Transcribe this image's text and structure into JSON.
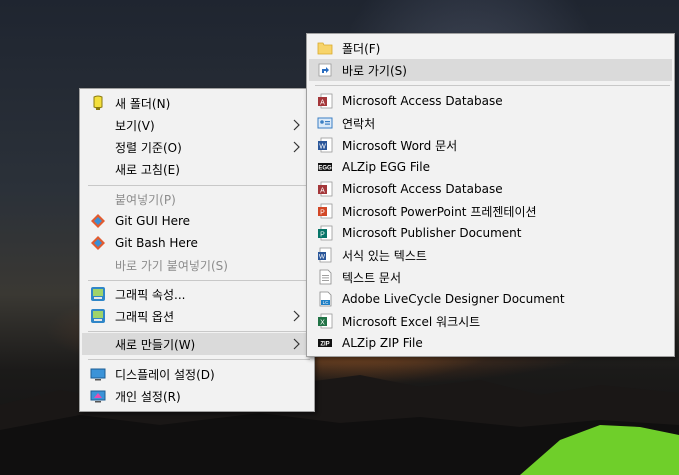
{
  "context_menu": {
    "items": [
      {
        "label": "새 폴더(N)",
        "icon": "new-folder-icon"
      },
      {
        "label": "보기(V)"
      },
      {
        "label": "정렬 기준(O)"
      },
      {
        "label": "새로 고침(E)"
      },
      {
        "label": "붙여넣기(P)"
      },
      {
        "label": "Git GUI Here",
        "icon": "git-gui-icon"
      },
      {
        "label": "Git Bash Here",
        "icon": "git-bash-icon"
      },
      {
        "label": "바로 가기 붙여넣기(S)"
      },
      {
        "label": "그래픽 속성...",
        "icon": "graphics-properties-icon"
      },
      {
        "label": "그래픽 옵션",
        "icon": "graphics-options-icon"
      },
      {
        "label": "새로 만들기(W)"
      },
      {
        "label": "디스플레이 설정(D)",
        "icon": "display-settings-icon"
      },
      {
        "label": "개인 설정(R)",
        "icon": "personalize-icon"
      }
    ]
  },
  "new_submenu": {
    "items": [
      {
        "label": "폴더(F)",
        "icon": "folder-icon"
      },
      {
        "label": "바로 가기(S)",
        "icon": "shortcut-icon"
      },
      {
        "label": "Microsoft Access Database",
        "icon": "access-icon"
      },
      {
        "label": "연락처",
        "icon": "contact-icon"
      },
      {
        "label": "Microsoft Word 문서",
        "icon": "word-icon"
      },
      {
        "label": "ALZip EGG File",
        "icon": "alzip-egg-icon"
      },
      {
        "label": "Microsoft Access Database",
        "icon": "access-icon"
      },
      {
        "label": "Microsoft PowerPoint 프레젠테이션",
        "icon": "powerpoint-icon"
      },
      {
        "label": "Microsoft Publisher Document",
        "icon": "publisher-icon"
      },
      {
        "label": "서식 있는 텍스트",
        "icon": "rich-text-icon"
      },
      {
        "label": "텍스트 문서",
        "icon": "text-document-icon"
      },
      {
        "label": "Adobe LiveCycle Designer Document",
        "icon": "livecycle-icon"
      },
      {
        "label": "Microsoft Excel 워크시트",
        "icon": "excel-icon"
      },
      {
        "label": "ALZip ZIP File",
        "icon": "alzip-zip-icon"
      }
    ]
  },
  "colors": {
    "menu_bg": "#f2f2f2",
    "highlight": "#dadada",
    "disabled_text": "#8c8c8c",
    "separator": "#c8c8c8"
  }
}
